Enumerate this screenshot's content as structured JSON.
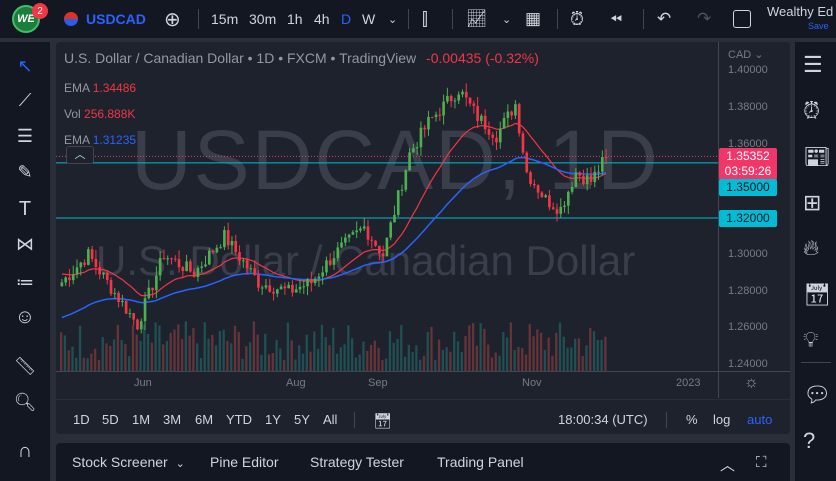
{
  "topbar": {
    "logo": "WE",
    "notif_count": "2",
    "symbol": "USDCAD",
    "timeframes": [
      "15m",
      "30m",
      "1h",
      "4h",
      "D",
      "W"
    ],
    "active_timeframe": "D",
    "layout_name": "Wealthy Ed",
    "save_label": "Save"
  },
  "legend": {
    "title": "U.S. Dollar / Canadian Dollar • 1D • FXCM • TradingView",
    "change": "-0.00435 (-0.32%)",
    "indicators": [
      {
        "name": "EMA",
        "value": "1.34486",
        "color": "#f05350"
      },
      {
        "name": "Vol",
        "value": "256.888K",
        "color": "#f05350"
      },
      {
        "name": "EMA",
        "value": "1.31235",
        "color": "#2962ff"
      }
    ]
  },
  "watermark": {
    "symbol": "USDCAD, 1D",
    "desc": "U.S. Dollar / Canadian Dollar"
  },
  "price_axis": {
    "currency": "CAD",
    "ticks": [
      "1.40000",
      "1.38000",
      "1.36000",
      "1.30000",
      "1.28000",
      "1.26000",
      "1.24000"
    ],
    "current_price": "1.35352",
    "countdown": "03:59:26",
    "lines": [
      "1.35000",
      "1.32000"
    ]
  },
  "time_axis": {
    "labels": [
      "Jun",
      "Aug",
      "Sep",
      "Nov",
      "2023"
    ]
  },
  "range_bar": {
    "ranges": [
      "1D",
      "5D",
      "1M",
      "3M",
      "6M",
      "YTD",
      "1Y",
      "5Y",
      "All"
    ],
    "clock": "18:00:34 (UTC)",
    "pct": "%",
    "log": "log",
    "auto": "auto"
  },
  "bottom_panel": {
    "tabs": [
      "Stock Screener",
      "Pine Editor",
      "Strategy Tester",
      "Trading Panel"
    ]
  },
  "colors": {
    "up": "#26a69a",
    "down": "#ef5350",
    "candle_up": "#4caf50",
    "candle_down": "#f23645",
    "accent": "#2962ff",
    "hline": "#00bcd4",
    "price_tag": "#f23669"
  },
  "chart_data": {
    "type": "candlestick",
    "symbol": "USDCAD",
    "interval": "1D",
    "ylim": [
      1.235,
      1.405
    ],
    "close_keypoints": [
      [
        0,
        1.285
      ],
      [
        7,
        1.3
      ],
      [
        12,
        1.285
      ],
      [
        20,
        1.262
      ],
      [
        27,
        1.3
      ],
      [
        35,
        1.29
      ],
      [
        43,
        1.31
      ],
      [
        52,
        1.285
      ],
      [
        60,
        1.28
      ],
      [
        66,
        1.285
      ],
      [
        72,
        1.3
      ],
      [
        80,
        1.315
      ],
      [
        85,
        1.3
      ],
      [
        92,
        1.355
      ],
      [
        97,
        1.372
      ],
      [
        105,
        1.39
      ],
      [
        110,
        1.375
      ],
      [
        115,
        1.365
      ],
      [
        120,
        1.382
      ],
      [
        123,
        1.345
      ],
      [
        128,
        1.33
      ],
      [
        132,
        1.325
      ],
      [
        136,
        1.345
      ],
      [
        140,
        1.34
      ],
      [
        144,
        1.353
      ]
    ],
    "ema_fast_last": 1.34486,
    "ema_slow_last": 1.31235,
    "hlines": [
      1.35,
      1.32
    ]
  }
}
